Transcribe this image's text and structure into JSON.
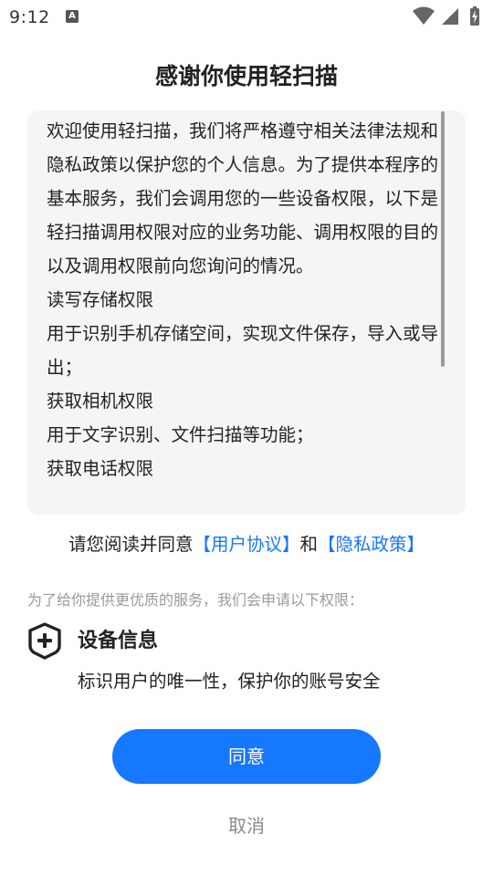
{
  "status_bar": {
    "time": "9:12",
    "notification_icon_letter": "A",
    "icons": [
      "wifi-icon",
      "cellular-signal-icon",
      "battery-charging-icon"
    ]
  },
  "dialog": {
    "title": "感谢你使用轻扫描",
    "policy_paragraphs": [
      "欢迎使用轻扫描，我们将严格遵守相关法律法规和隐私政策以保护您的个人信息。为了提供本程序的基本服务，我们会调用您的一些设备权限，以下是轻扫描调用权限对应的业务功能、调用权限的目的以及调用权限前向您询问的情况。",
      "读写存储权限",
      "用于识别手机存储空间，实现文件保存，导入或导出；",
      "获取相机权限",
      "用于文字识别、文件扫描等功能；",
      "获取电话权限"
    ],
    "agree_prefix": "请您阅读并同意",
    "user_agreement_link": "【用户协议】",
    "and_text": "和",
    "privacy_policy_link": "【隐私政策】",
    "permission_intro": "为了给你提供更优质的服务，我们会申请以下权限：",
    "permission_icon": "shield-plus-icon",
    "permission_title": "设备信息",
    "permission_desc": "标识用户的唯一性，保护你的账号安全",
    "agree_button_label": "同意",
    "cancel_button_label": "取消"
  },
  "colors": {
    "accent": "#1677ff",
    "box_background": "#f4f5f7",
    "muted_text": "#9a9a9a"
  }
}
